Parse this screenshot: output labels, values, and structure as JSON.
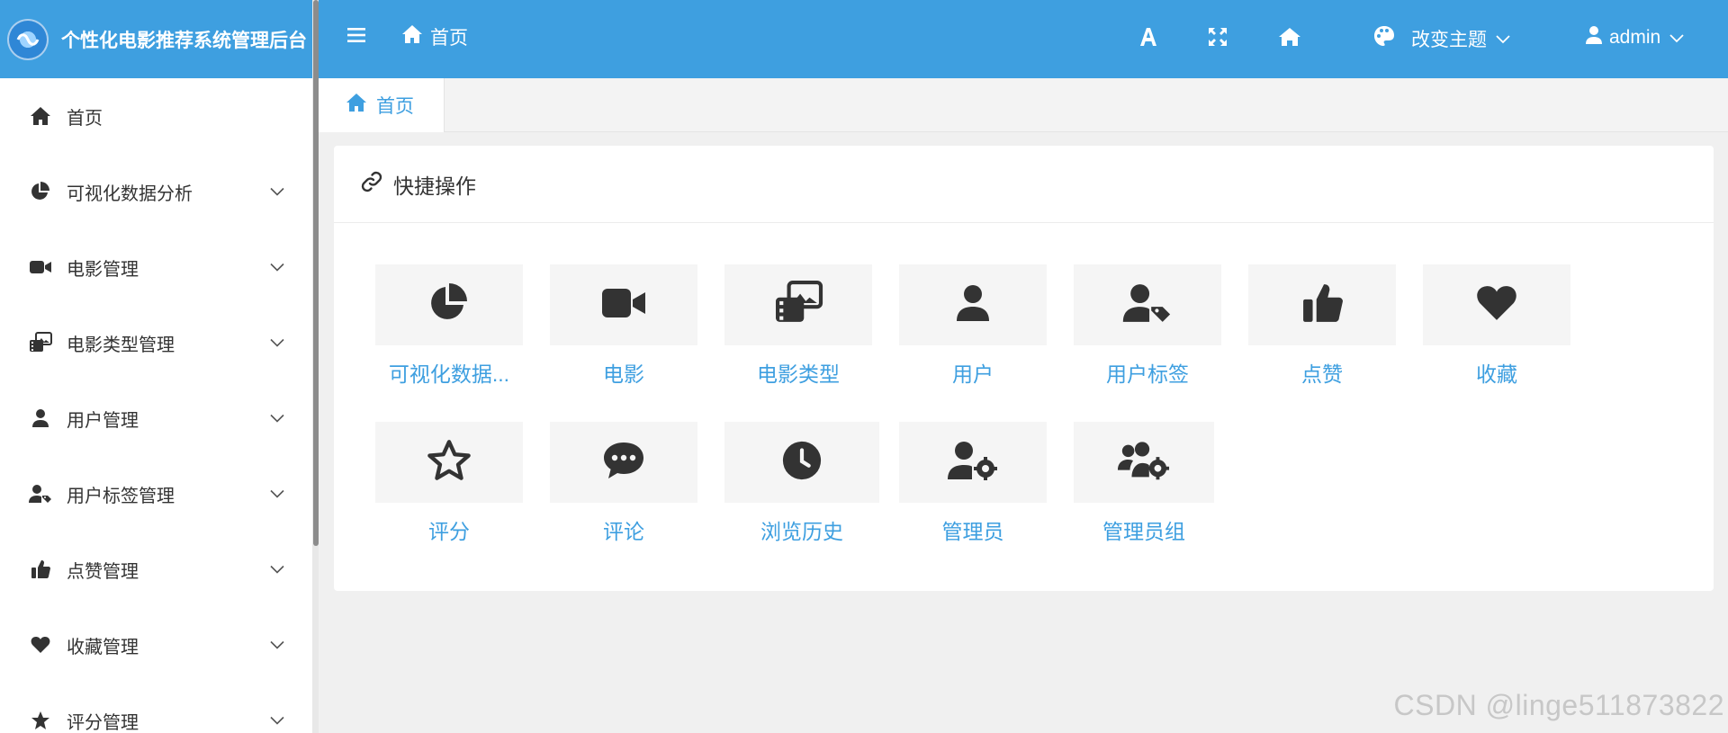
{
  "brand": {
    "title": "个性化电影推荐系统管理后台",
    "logo_icon": "film-logo-icon"
  },
  "header": {
    "breadcrumb": "首页",
    "theme_label": "改变主题",
    "user_label": "admin",
    "bg_color": "#3e9fe0"
  },
  "sidebar": {
    "items": [
      {
        "label": "首页",
        "icon": "home-icon"
      },
      {
        "label": "可视化数据分析",
        "icon": "pie-chart-icon"
      },
      {
        "label": "电影管理",
        "icon": "video-camera-icon"
      },
      {
        "label": "电影类型管理",
        "icon": "photo-film-icon"
      },
      {
        "label": "用户管理",
        "icon": "user-icon"
      },
      {
        "label": "用户标签管理",
        "icon": "user-tag-icon"
      },
      {
        "label": "点赞管理",
        "icon": "thumbs-up-icon"
      },
      {
        "label": "收藏管理",
        "icon": "heart-icon"
      },
      {
        "label": "评分管理",
        "icon": "star-icon"
      }
    ]
  },
  "tabs": {
    "active": "首页"
  },
  "quick": {
    "title": "快捷操作",
    "tiles": [
      {
        "label": "可视化数据...",
        "icon": "pie-chart-icon"
      },
      {
        "label": "电影",
        "icon": "video-camera-icon"
      },
      {
        "label": "电影类型",
        "icon": "photo-film-icon"
      },
      {
        "label": "用户",
        "icon": "user-icon"
      },
      {
        "label": "用户标签",
        "icon": "user-tag-icon"
      },
      {
        "label": "点赞",
        "icon": "thumbs-up-icon"
      },
      {
        "label": "收藏",
        "icon": "heart-icon"
      },
      {
        "label": "评分",
        "icon": "star-outline-icon"
      },
      {
        "label": "评论",
        "icon": "comment-dots-icon"
      },
      {
        "label": "浏览历史",
        "icon": "clock-icon"
      },
      {
        "label": "管理员",
        "icon": "user-gear-icon"
      },
      {
        "label": "管理员组",
        "icon": "users-gear-icon"
      }
    ]
  },
  "watermark": "CSDN @linge511873822"
}
